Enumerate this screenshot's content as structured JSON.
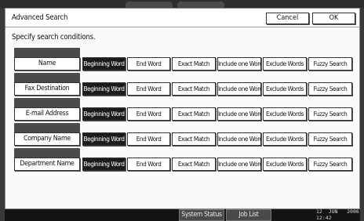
{
  "header": {
    "title": "Advanced Search",
    "cancel_label": "Cancel",
    "ok_label": "OK"
  },
  "subtitle": "Specify search conditions.",
  "options": [
    "Beginning Word",
    "End Word",
    "Exact Match",
    "Include one Word",
    "Exclude Words",
    "Fuzzy Search"
  ],
  "rows": [
    {
      "field": "Name",
      "selected": "Beginning Word"
    },
    {
      "field": "Fax Destination",
      "selected": "Beginning Word"
    },
    {
      "field": "E-mail Address",
      "selected": "Beginning Word"
    },
    {
      "field": "Company Name",
      "selected": "Beginning Word"
    },
    {
      "field": "Department Name",
      "selected": "Beginning Word"
    }
  ],
  "status_bar": {
    "system_status_label": "System Status",
    "job_list_label": "Job List",
    "date": "12  JUN   2006",
    "time": "12:42"
  }
}
